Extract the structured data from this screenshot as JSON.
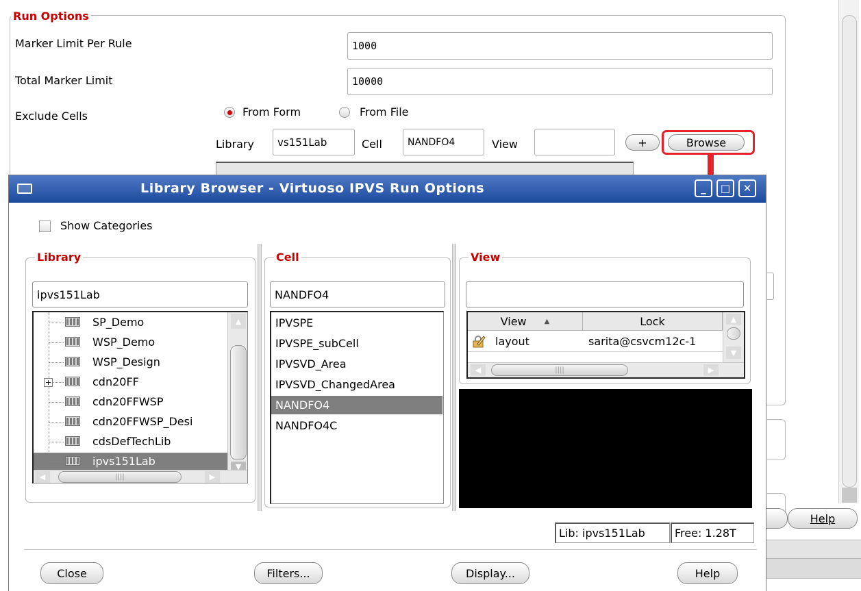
{
  "run_options": {
    "group_title": "Run Options",
    "marker_limit_label": "Marker Limit Per Rule",
    "marker_limit_value": "1000",
    "total_marker_label": "Total Marker Limit",
    "total_marker_value": "10000",
    "exclude_cells_label": "Exclude Cells",
    "radio_from_form": "From Form",
    "radio_from_file": "From File",
    "radio_selected": "From Form",
    "library_label": "Library",
    "library_value": "vs151Lab",
    "cell_label": "Cell",
    "cell_value": "NANDFO4",
    "view_label": "View",
    "view_value": "",
    "add_button": "+",
    "browse_button": "Browse",
    "help_button": "Help"
  },
  "dialog": {
    "title": "Library Browser - Virtuoso IPVS Run Options",
    "show_categories_label": "Show Categories",
    "library_group_title": "Library",
    "library_filter": "ipvs151Lab",
    "libraries": [
      {
        "name": "SP_Demo",
        "expandable": false,
        "selected": false
      },
      {
        "name": "WSP_Demo",
        "expandable": false,
        "selected": false
      },
      {
        "name": "WSP_Design",
        "expandable": false,
        "selected": false
      },
      {
        "name": "cdn20FF",
        "expandable": true,
        "selected": false
      },
      {
        "name": "cdn20FFWSP",
        "expandable": false,
        "selected": false
      },
      {
        "name": "cdn20FFWSP_Desi",
        "expandable": false,
        "selected": false
      },
      {
        "name": "cdsDefTechLib",
        "expandable": false,
        "selected": false
      },
      {
        "name": "ipvs151Lab",
        "expandable": false,
        "selected": true
      }
    ],
    "cell_group_title": "Cell",
    "cell_filter": "NANDFO4",
    "cells": [
      {
        "name": "IPVSPE",
        "selected": false
      },
      {
        "name": "IPVSPE_subCell",
        "selected": false
      },
      {
        "name": "IPVSVD_Area",
        "selected": false
      },
      {
        "name": "IPVSVD_ChangedArea",
        "selected": false
      },
      {
        "name": "NANDFO4",
        "selected": true
      },
      {
        "name": "NANDFO4C",
        "selected": false
      }
    ],
    "view_group_title": "View",
    "view_filter": "",
    "view_table": {
      "columns": [
        "View",
        "Lock"
      ],
      "rows": [
        {
          "view": "layout",
          "lock": "sarita@csvcm12c-1",
          "icon": "lock-pencil-icon"
        }
      ]
    },
    "status_lib": "Lib: ipvs151Lab",
    "status_free": "Free: 1.28T",
    "buttons": {
      "close": "Close",
      "filters": "Filters...",
      "display": "Display...",
      "help": "Help"
    }
  },
  "colors": {
    "group_title": "#c80000",
    "titlebar_top": "#4f79c5",
    "titlebar_bottom": "#1c4a9c",
    "selection": "#7f7f7f",
    "annotation_red": "#e8202a"
  }
}
